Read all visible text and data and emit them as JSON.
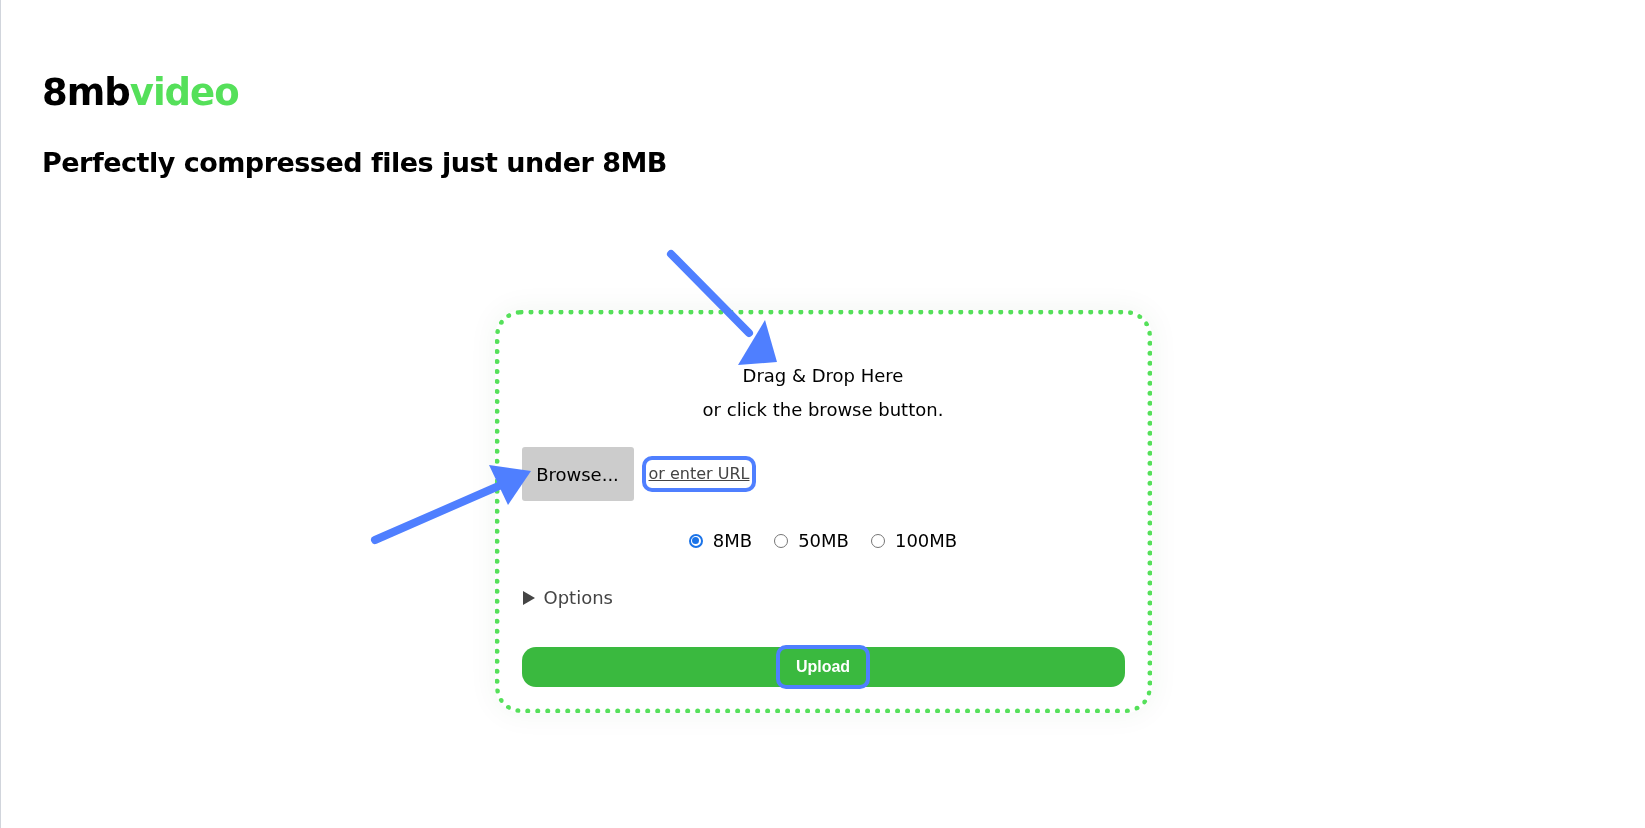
{
  "logo": {
    "text_1": "8mb",
    "text_2": "video"
  },
  "tagline": "Perfectly compressed files just under 8MB",
  "dropzone": {
    "title": "Drag & Drop Here",
    "hint": "or click the browse button.",
    "browse_button": "Browse...",
    "url_link": {
      "label": "or enter URL",
      "highlighted": true
    },
    "sizes": [
      {
        "label": "8MB",
        "selected": true
      },
      {
        "label": "50MB",
        "selected": false
      },
      {
        "label": "100MB",
        "selected": false
      }
    ],
    "options": {
      "label": "Options",
      "expanded": false
    },
    "upload_button": {
      "label": "Upload",
      "highlighted": true
    }
  }
}
